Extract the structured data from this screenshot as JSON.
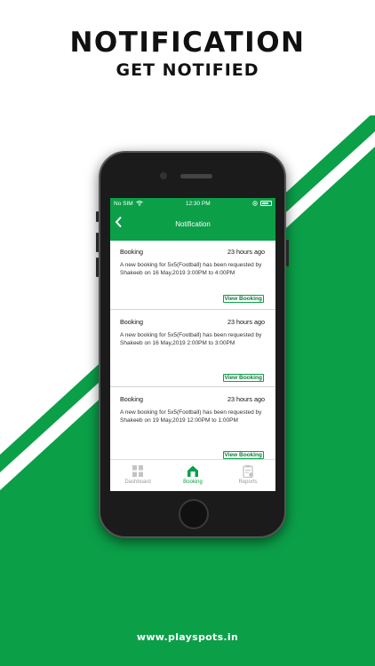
{
  "headline": "NOTIFICATION",
  "subheadline": "GET NOTIFIED",
  "footer_url": "www.playspots.in",
  "colors": {
    "brand_green": "#0b9f48",
    "text_dark": "#111111"
  },
  "status_bar": {
    "carrier": "No SIM",
    "time": "12:30 PM"
  },
  "app_bar": {
    "back_icon": "chevron-left-icon",
    "title": "Notification"
  },
  "notifications": [
    {
      "title": "Booking",
      "time_ago": "23 hours ago",
      "message": "A new booking  for 5x5(Football)  has been requested by Shakeeb on 16 May,2019 3:00PM  to 4:00PM",
      "action": "View Booking"
    },
    {
      "title": "Booking",
      "time_ago": "23 hours ago",
      "message": "A new booking  for 5x5(Football)  has been requested by Shakeeb on 16 May,2019 2:00PM  to 3:00PM",
      "action": "View Booking"
    },
    {
      "title": "Booking",
      "time_ago": "23 hours ago",
      "message": "A new booking  for 5x5(Football)  has been requested by Shakeeb on 19 May,2019 12:00PM to 1:00PM",
      "action": "View Booking"
    }
  ],
  "tabs": [
    {
      "label": "Dashboard",
      "icon": "grid-icon",
      "active": false
    },
    {
      "label": "Booking",
      "icon": "home-icon",
      "active": true
    },
    {
      "label": "Reports",
      "icon": "clipboard-icon",
      "active": false
    }
  ]
}
